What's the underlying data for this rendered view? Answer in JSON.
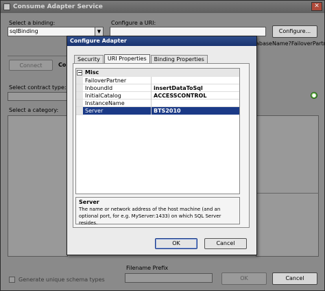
{
  "window": {
    "title": "Consume Adapter Service",
    "close_glyph": "✕"
  },
  "main": {
    "select_binding_label": "Select a binding:",
    "binding_value": "sqlBinding",
    "configure_uri_label": "Configure a URI:",
    "uri_value": "",
    "configure_button": "Configure...",
    "uri_hint": "abaseName?FailoverPartner",
    "connect_button": "Connect",
    "connect_status": "Co",
    "contract_type_label": "Select contract type:",
    "category_label": "Select a category:",
    "filename_prefix_label": "Filename Prefix",
    "filename_prefix_value": "",
    "generate_schemas_label": "Generate unique schema types",
    "ok_button": "OK",
    "cancel_button": "Cancel"
  },
  "dialog": {
    "title": "Configure Adapter",
    "tabs": [
      {
        "label": "Security"
      },
      {
        "label": "URI Properties"
      },
      {
        "label": "Binding Properties"
      }
    ],
    "active_tab": "URI Properties",
    "grid": {
      "category": "Misc",
      "expander_glyph": "−",
      "rows": [
        {
          "name": "FailoverPartner",
          "value": ""
        },
        {
          "name": "InboundId",
          "value": "insertDataToSql"
        },
        {
          "name": "InitialCatalog",
          "value": "ACCESSCONTROL"
        },
        {
          "name": "InstanceName",
          "value": ""
        },
        {
          "name": "Server",
          "value": "BTS2010"
        }
      ],
      "selected_row": "Server"
    },
    "description": {
      "title": "Server",
      "text": "The name or network address of the host machine (and an optional port, for e.g. MyServer:1433) on which SQL Server resides."
    },
    "ok_button": "OK",
    "cancel_button": "Cancel"
  }
}
